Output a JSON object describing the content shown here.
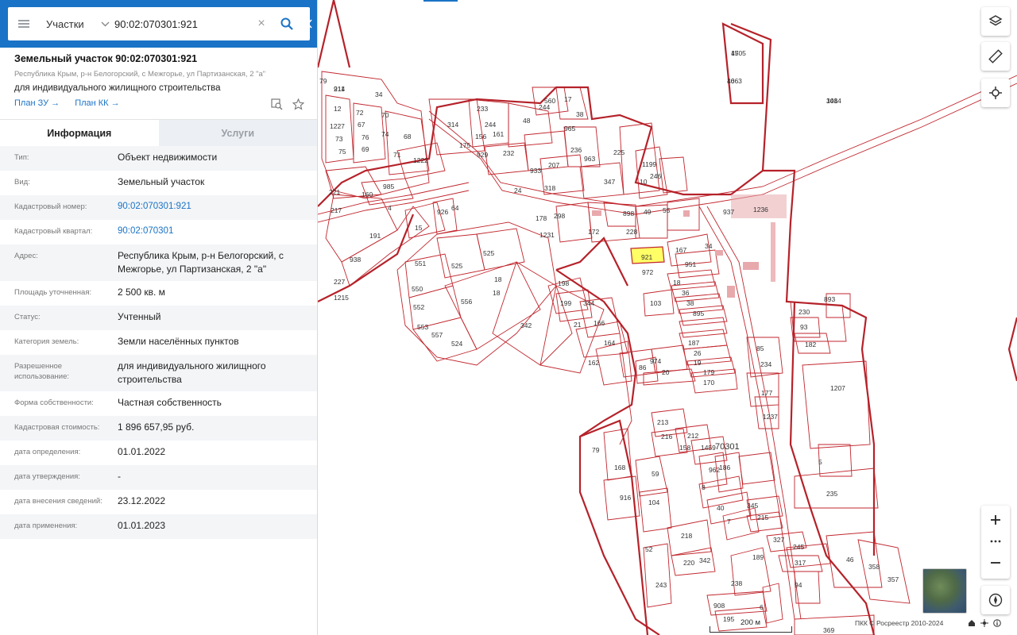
{
  "search": {
    "type_label": "Участки",
    "value": "90:02:070301:921"
  },
  "parcel": {
    "title": "Земельный участок 90:02:070301:921",
    "address_line": "Республика Крым, р-н Белогорский, с Межгорье, ул Партизанская, 2 \"а\"",
    "purpose": "для индивидуального жилищного строительства",
    "plan_zu": "План ЗУ →",
    "plan_kk": "План КК →"
  },
  "tabs": [
    {
      "label": "Информация",
      "active": true
    },
    {
      "label": "Услуги",
      "active": false
    }
  ],
  "info": [
    {
      "key": "Тип:",
      "value": "Объект недвижимости"
    },
    {
      "key": "Вид:",
      "value": "Земельный участок"
    },
    {
      "key": "Кадастровый номер:",
      "value": "90:02:070301:921",
      "link": true
    },
    {
      "key": "Кадастровый квартал:",
      "value": "90:02:070301",
      "link": true
    },
    {
      "key": "Адрес:",
      "value": "Республика Крым, р-н Белогорский, с Межгорье, ул Партизанская, 2 \"а\""
    },
    {
      "key": "Площадь уточненная:",
      "value": "2 500 кв. м"
    },
    {
      "key": "Статус:",
      "value": "Учтенный"
    },
    {
      "key": "Категория земель:",
      "value": "Земли населённых пунктов"
    },
    {
      "key": "Разрешенное использование:",
      "value": "для индивидуального жилищного строительства"
    },
    {
      "key": "Форма собственности:",
      "value": "Частная собственность"
    },
    {
      "key": "Кадастровая стоимость:",
      "value": "1 896 657,95 руб."
    },
    {
      "key": "дата определения:",
      "value": "01.01.2022"
    },
    {
      "key": "дата утверждения:",
      "value": "-"
    },
    {
      "key": "дата внесения сведений:",
      "value": "23.12.2022"
    },
    {
      "key": "дата применения:",
      "value": "01.01.2023"
    }
  ],
  "map": {
    "quarter_label": "70301",
    "selected_parcel": "921",
    "scale_label": "200 м",
    "attribution": "ПКК © Росреестр 2010-2024",
    "parcel_labels": [
      "45",
      "46",
      "308",
      "211",
      "79",
      "34",
      "12",
      "72",
      "70",
      "1227",
      "67",
      "73",
      "76",
      "74",
      "68",
      "75",
      "69",
      "71",
      "1222",
      "221",
      "160",
      "985",
      "217",
      "4",
      "938",
      "191",
      "227",
      "1215",
      "15",
      "926",
      "64",
      "551",
      "525",
      "525",
      "550",
      "18",
      "556",
      "552",
      "553",
      "557",
      "524",
      "342",
      "18",
      "198",
      "199",
      "344",
      "166",
      "21",
      "164",
      "162",
      "86",
      "974",
      "20",
      "560",
      "17",
      "38",
      "244",
      "233",
      "244",
      "314",
      "175",
      "156",
      "48",
      "161",
      "965",
      "929",
      "232",
      "236",
      "963",
      "933",
      "207",
      "24",
      "318",
      "225",
      "1199",
      "10",
      "246",
      "347",
      "298",
      "178",
      "1231",
      "898",
      "49",
      "55",
      "172",
      "228",
      "937",
      "1236",
      "167",
      "34",
      "951",
      "972",
      "18",
      "36",
      "38",
      "895",
      "187",
      "26",
      "19",
      "179",
      "170",
      "103",
      "85",
      "234",
      "177",
      "1237",
      "230",
      "93",
      "893",
      "182",
      "1207",
      "213",
      "216",
      "212",
      "1459",
      "158",
      "962",
      "186",
      "168",
      "59",
      "916",
      "104",
      "8",
      "40",
      "7",
      "345",
      "215",
      "218",
      "220",
      "342",
      "52",
      "243",
      "189",
      "238",
      "94",
      "327",
      "245",
      "317",
      "46",
      "358",
      "357",
      "908",
      "195",
      "6",
      "5",
      "235",
      "369",
      "79",
      "1705",
      "1063",
      "1414",
      "914"
    ]
  },
  "colors": {
    "header_blue": "#1a73c6",
    "parcel_line": "#c0262d",
    "selected_fill": "#ffff66",
    "building_fill": "#e8a9ad"
  },
  "icons": {
    "layers": "layers-icon",
    "ruler": "ruler-icon",
    "locate": "locate-icon",
    "zoom_in": "plus-icon",
    "zoom_out": "minus-icon",
    "compass": "compass-icon"
  }
}
